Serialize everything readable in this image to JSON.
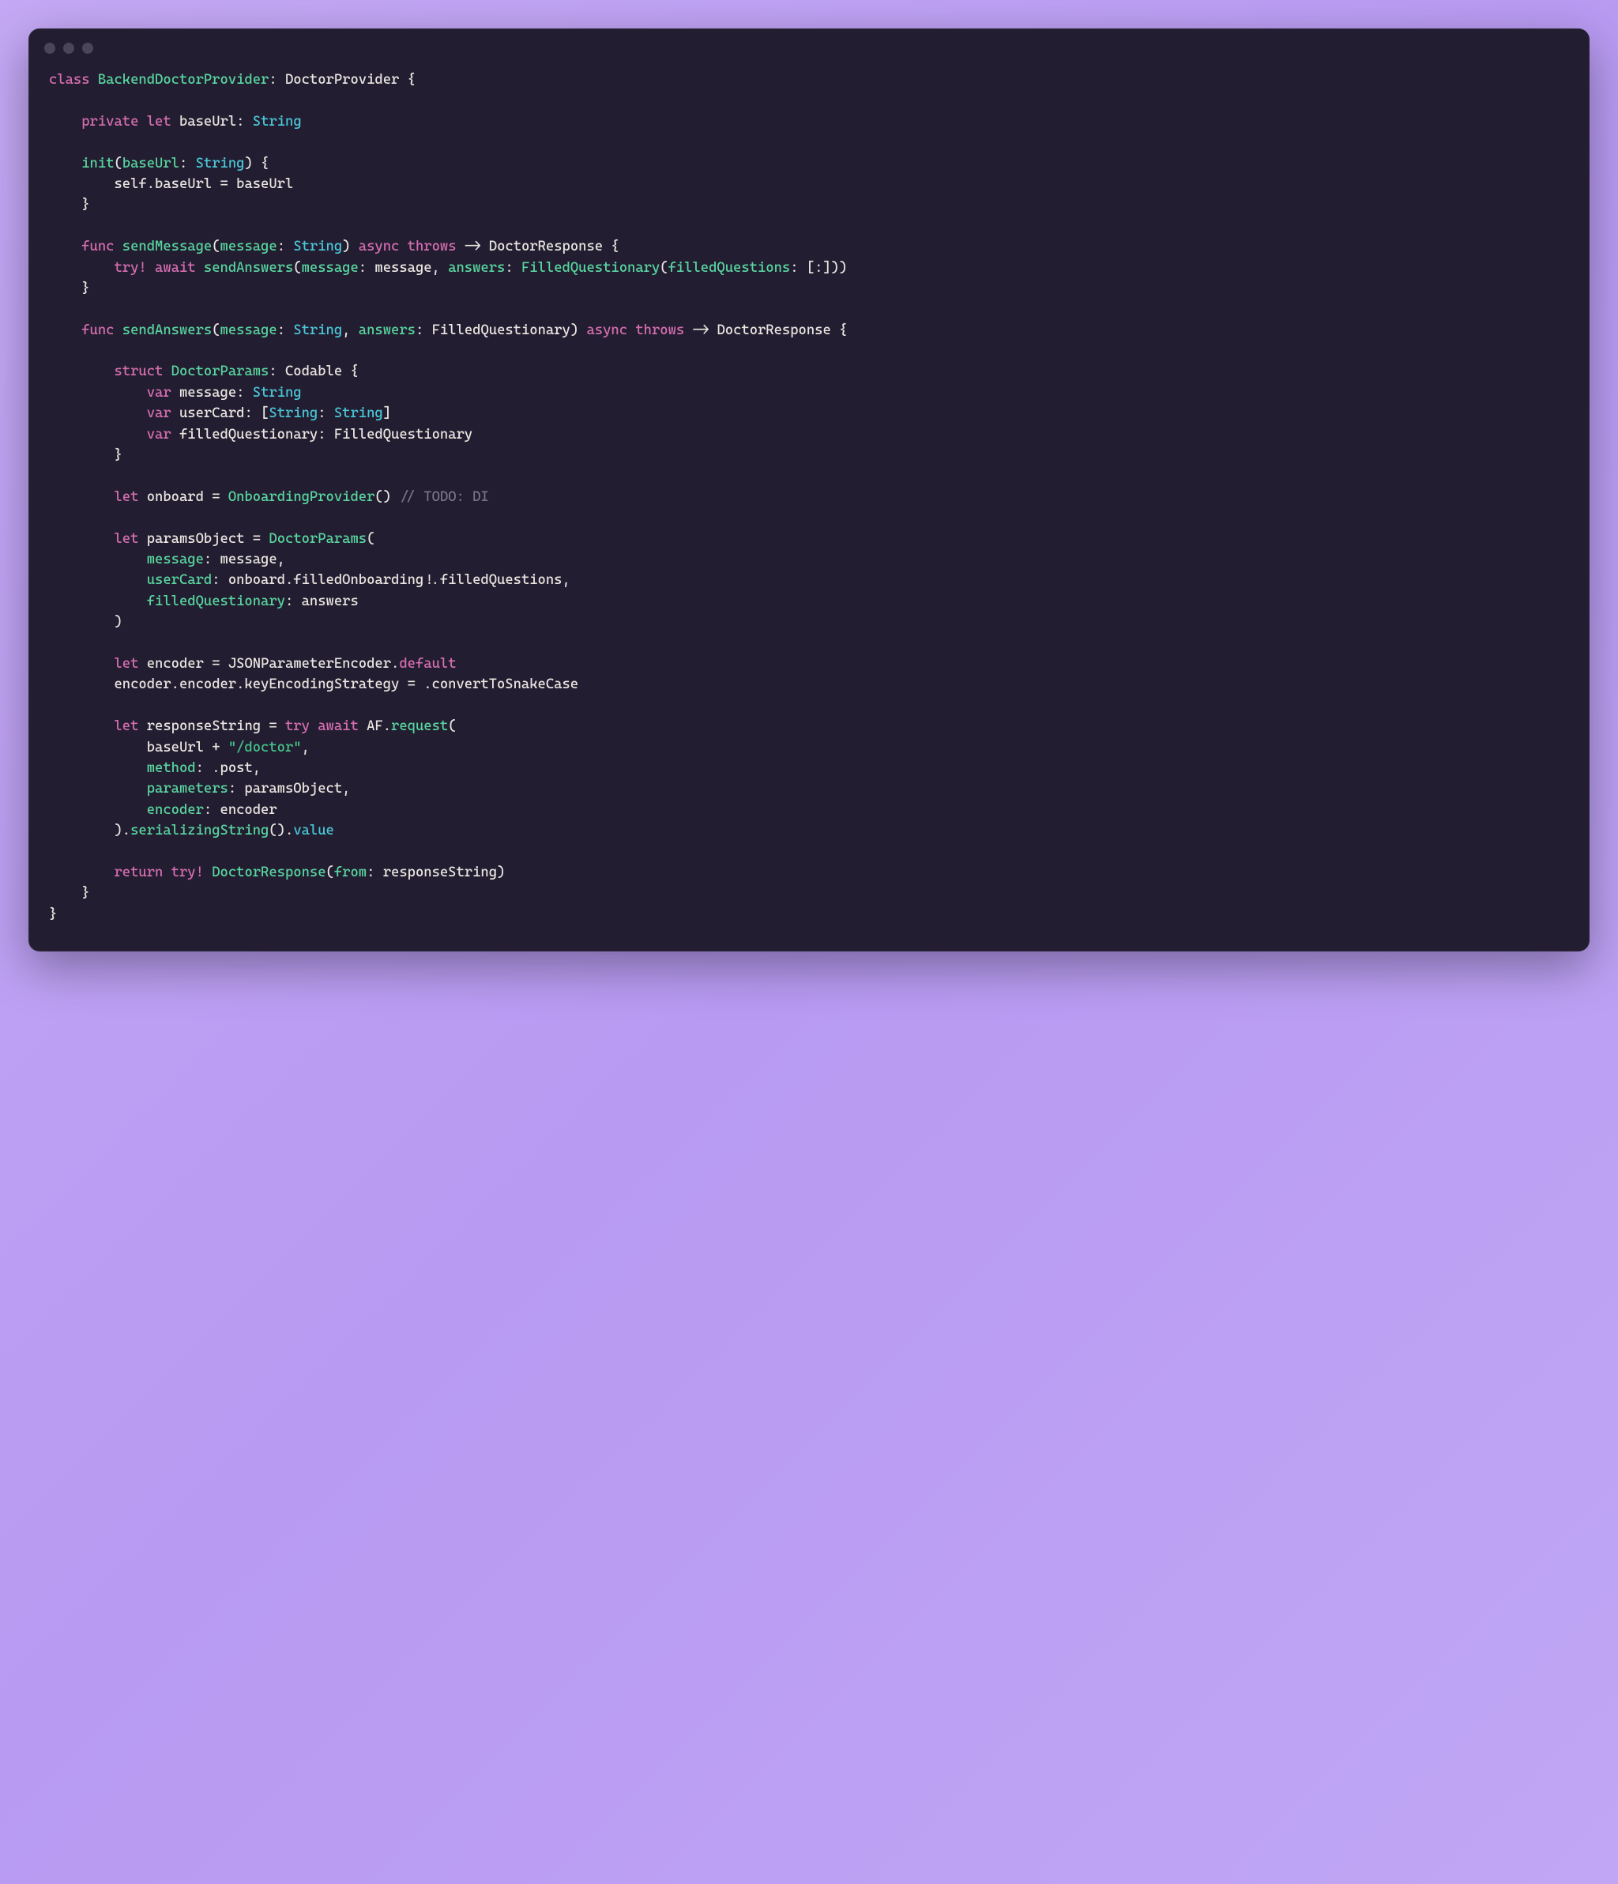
{
  "code": {
    "tokens": [
      {
        "t": "class ",
        "c": "kw"
      },
      {
        "t": "BackendDoctorProvider",
        "c": "fn"
      },
      {
        "t": ": ",
        "c": "pl"
      },
      {
        "t": "DoctorProvider",
        "c": "pl"
      },
      {
        "t": " {\n\n",
        "c": "pl"
      },
      {
        "t": "    ",
        "c": "pl"
      },
      {
        "t": "private ",
        "c": "kw"
      },
      {
        "t": "let ",
        "c": "kw"
      },
      {
        "t": "baseUrl",
        "c": "pl"
      },
      {
        "t": ": ",
        "c": "pl"
      },
      {
        "t": "String",
        "c": "typ"
      },
      {
        "t": "\n\n",
        "c": "pl"
      },
      {
        "t": "    ",
        "c": "pl"
      },
      {
        "t": "init",
        "c": "fn"
      },
      {
        "t": "(",
        "c": "pl"
      },
      {
        "t": "baseUrl",
        "c": "fn"
      },
      {
        "t": ": ",
        "c": "pl"
      },
      {
        "t": "String",
        "c": "typ"
      },
      {
        "t": ") {\n",
        "c": "pl"
      },
      {
        "t": "        self.",
        "c": "pl"
      },
      {
        "t": "baseUrl",
        "c": "pl"
      },
      {
        "t": " = baseUrl\n",
        "c": "pl"
      },
      {
        "t": "    }\n\n",
        "c": "pl"
      },
      {
        "t": "    ",
        "c": "pl"
      },
      {
        "t": "func ",
        "c": "kw"
      },
      {
        "t": "sendMessage",
        "c": "fn"
      },
      {
        "t": "(",
        "c": "pl"
      },
      {
        "t": "message",
        "c": "fn"
      },
      {
        "t": ": ",
        "c": "pl"
      },
      {
        "t": "String",
        "c": "typ"
      },
      {
        "t": ") ",
        "c": "pl"
      },
      {
        "t": "async ",
        "c": "kw"
      },
      {
        "t": "throws ",
        "c": "kw"
      },
      {
        "t": "-> ",
        "c": "pl"
      },
      {
        "t": "DoctorResponse",
        "c": "pl"
      },
      {
        "t": " {\n",
        "c": "pl"
      },
      {
        "t": "        ",
        "c": "pl"
      },
      {
        "t": "try! ",
        "c": "kw"
      },
      {
        "t": "await ",
        "c": "kw"
      },
      {
        "t": "sendAnswers",
        "c": "fn"
      },
      {
        "t": "(",
        "c": "pl"
      },
      {
        "t": "message",
        "c": "fn"
      },
      {
        "t": ": message, ",
        "c": "pl"
      },
      {
        "t": "answers",
        "c": "fn"
      },
      {
        "t": ": ",
        "c": "pl"
      },
      {
        "t": "FilledQuestionary",
        "c": "fn"
      },
      {
        "t": "(",
        "c": "pl"
      },
      {
        "t": "filledQuestions",
        "c": "fn"
      },
      {
        "t": ": [:]))\n",
        "c": "pl"
      },
      {
        "t": "    }\n\n",
        "c": "pl"
      },
      {
        "t": "    ",
        "c": "pl"
      },
      {
        "t": "func ",
        "c": "kw"
      },
      {
        "t": "sendAnswers",
        "c": "fn"
      },
      {
        "t": "(",
        "c": "pl"
      },
      {
        "t": "message",
        "c": "fn"
      },
      {
        "t": ": ",
        "c": "pl"
      },
      {
        "t": "String",
        "c": "typ"
      },
      {
        "t": ", ",
        "c": "pl"
      },
      {
        "t": "answers",
        "c": "fn"
      },
      {
        "t": ": ",
        "c": "pl"
      },
      {
        "t": "FilledQuestionary",
        "c": "pl"
      },
      {
        "t": ") ",
        "c": "pl"
      },
      {
        "t": "async ",
        "c": "kw"
      },
      {
        "t": "throws ",
        "c": "kw"
      },
      {
        "t": "-> ",
        "c": "pl"
      },
      {
        "t": "DoctorResponse",
        "c": "pl"
      },
      {
        "t": " {\n\n",
        "c": "pl"
      },
      {
        "t": "        ",
        "c": "pl"
      },
      {
        "t": "struct ",
        "c": "kw"
      },
      {
        "t": "DoctorParams",
        "c": "fn"
      },
      {
        "t": ": ",
        "c": "pl"
      },
      {
        "t": "Codable",
        "c": "pl"
      },
      {
        "t": " {\n",
        "c": "pl"
      },
      {
        "t": "            ",
        "c": "pl"
      },
      {
        "t": "var ",
        "c": "kw"
      },
      {
        "t": "message",
        "c": "pl"
      },
      {
        "t": ": ",
        "c": "pl"
      },
      {
        "t": "String",
        "c": "typ"
      },
      {
        "t": "\n",
        "c": "pl"
      },
      {
        "t": "            ",
        "c": "pl"
      },
      {
        "t": "var ",
        "c": "kw"
      },
      {
        "t": "userCard",
        "c": "pl"
      },
      {
        "t": ": [",
        "c": "pl"
      },
      {
        "t": "String",
        "c": "typ"
      },
      {
        "t": ": ",
        "c": "pl"
      },
      {
        "t": "String",
        "c": "typ"
      },
      {
        "t": "]\n",
        "c": "pl"
      },
      {
        "t": "            ",
        "c": "pl"
      },
      {
        "t": "var ",
        "c": "kw"
      },
      {
        "t": "filledQuestionary",
        "c": "pl"
      },
      {
        "t": ": ",
        "c": "pl"
      },
      {
        "t": "FilledQuestionary",
        "c": "pl"
      },
      {
        "t": "\n",
        "c": "pl"
      },
      {
        "t": "        }\n\n",
        "c": "pl"
      },
      {
        "t": "        ",
        "c": "pl"
      },
      {
        "t": "let ",
        "c": "kw"
      },
      {
        "t": "onboard",
        "c": "pl"
      },
      {
        "t": " = ",
        "c": "pl"
      },
      {
        "t": "OnboardingProvider",
        "c": "fn"
      },
      {
        "t": "() ",
        "c": "pl"
      },
      {
        "t": "// TODO: DI",
        "c": "com"
      },
      {
        "t": "\n\n",
        "c": "pl"
      },
      {
        "t": "        ",
        "c": "pl"
      },
      {
        "t": "let ",
        "c": "kw"
      },
      {
        "t": "paramsObject",
        "c": "pl"
      },
      {
        "t": " = ",
        "c": "pl"
      },
      {
        "t": "DoctorParams",
        "c": "fn"
      },
      {
        "t": "(\n",
        "c": "pl"
      },
      {
        "t": "            ",
        "c": "pl"
      },
      {
        "t": "message",
        "c": "fn"
      },
      {
        "t": ": message,\n",
        "c": "pl"
      },
      {
        "t": "            ",
        "c": "pl"
      },
      {
        "t": "userCard",
        "c": "fn"
      },
      {
        "t": ": onboard.filledOnboarding!.filledQuestions,\n",
        "c": "pl"
      },
      {
        "t": "            ",
        "c": "pl"
      },
      {
        "t": "filledQuestionary",
        "c": "fn"
      },
      {
        "t": ": answers\n",
        "c": "pl"
      },
      {
        "t": "        )\n\n",
        "c": "pl"
      },
      {
        "t": "        ",
        "c": "pl"
      },
      {
        "t": "let ",
        "c": "kw"
      },
      {
        "t": "encoder",
        "c": "pl"
      },
      {
        "t": " = ",
        "c": "pl"
      },
      {
        "t": "JSONParameterEncoder",
        "c": "pl"
      },
      {
        "t": ".",
        "c": "pl"
      },
      {
        "t": "default",
        "c": "kw"
      },
      {
        "t": "\n",
        "c": "pl"
      },
      {
        "t": "        encoder.encoder.keyEncodingStrategy = .convertToSnakeCase\n\n",
        "c": "pl"
      },
      {
        "t": "        ",
        "c": "pl"
      },
      {
        "t": "let ",
        "c": "kw"
      },
      {
        "t": "responseString",
        "c": "pl"
      },
      {
        "t": " = ",
        "c": "pl"
      },
      {
        "t": "try ",
        "c": "kw"
      },
      {
        "t": "await ",
        "c": "kw"
      },
      {
        "t": "AF.",
        "c": "pl"
      },
      {
        "t": "request",
        "c": "fn"
      },
      {
        "t": "(\n",
        "c": "pl"
      },
      {
        "t": "            baseUrl + ",
        "c": "pl"
      },
      {
        "t": "\"/doctor\"",
        "c": "str"
      },
      {
        "t": ",\n",
        "c": "pl"
      },
      {
        "t": "            ",
        "c": "pl"
      },
      {
        "t": "method",
        "c": "fn"
      },
      {
        "t": ": .post,\n",
        "c": "pl"
      },
      {
        "t": "            ",
        "c": "pl"
      },
      {
        "t": "parameters",
        "c": "fn"
      },
      {
        "t": ": paramsObject,\n",
        "c": "pl"
      },
      {
        "t": "            ",
        "c": "pl"
      },
      {
        "t": "encoder",
        "c": "fn"
      },
      {
        "t": ": encoder\n",
        "c": "pl"
      },
      {
        "t": "        ).",
        "c": "pl"
      },
      {
        "t": "serializingString",
        "c": "fn"
      },
      {
        "t": "().",
        "c": "pl"
      },
      {
        "t": "value",
        "c": "typ"
      },
      {
        "t": "\n\n",
        "c": "pl"
      },
      {
        "t": "        ",
        "c": "pl"
      },
      {
        "t": "return ",
        "c": "kw"
      },
      {
        "t": "try! ",
        "c": "kw"
      },
      {
        "t": "DoctorResponse",
        "c": "fn"
      },
      {
        "t": "(",
        "c": "pl"
      },
      {
        "t": "from",
        "c": "fn"
      },
      {
        "t": ": responseString)\n",
        "c": "pl"
      },
      {
        "t": "    }\n",
        "c": "pl"
      },
      {
        "t": "}",
        "c": "pl"
      }
    ]
  }
}
